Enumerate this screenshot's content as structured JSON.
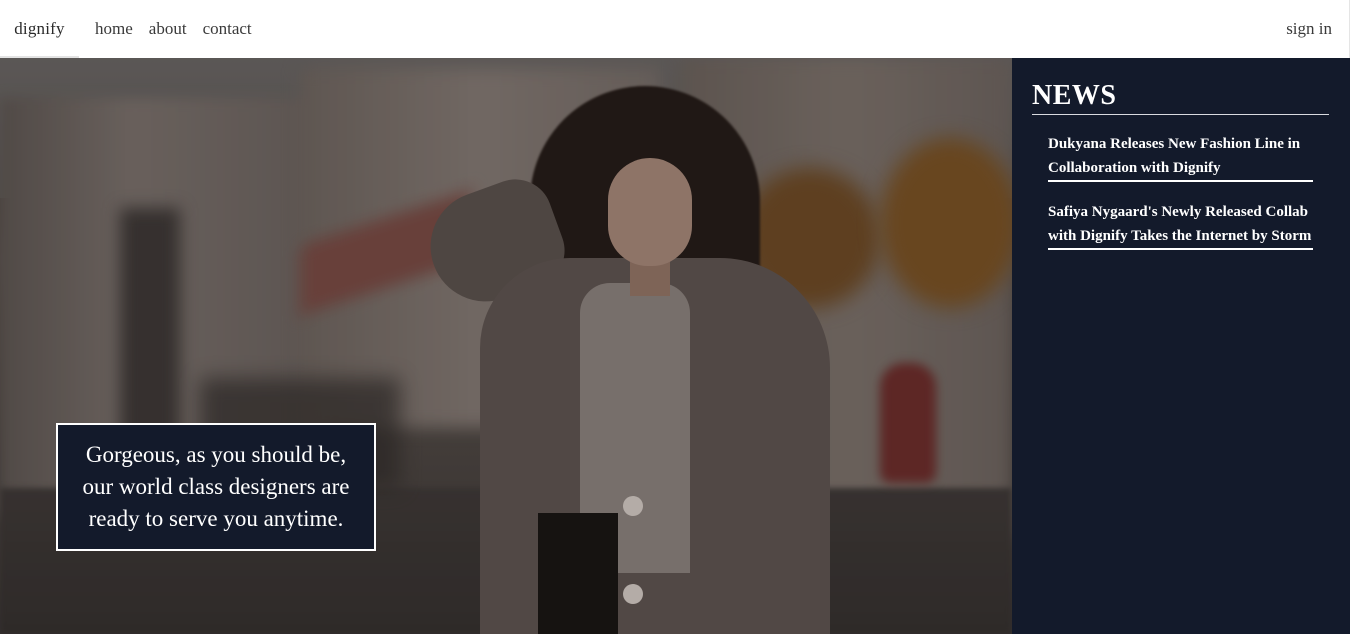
{
  "navbar": {
    "brand": "dignify",
    "links": [
      "home",
      "about",
      "contact"
    ],
    "sign_in": "sign in"
  },
  "hero": {
    "caption": "Gorgeous, as you should be, our world class designers are ready to serve you anytime."
  },
  "news": {
    "title": "NEWS",
    "items": [
      "Dukyana Releases New Fashion Line in Collaboration with Dignify",
      "Safiya Nygaard's Newly Released Collab with Dignify Takes the Internet by Storm"
    ]
  },
  "colors": {
    "navy": "#131a2b",
    "white": "#ffffff",
    "nav_text": "#3a3a3a"
  }
}
